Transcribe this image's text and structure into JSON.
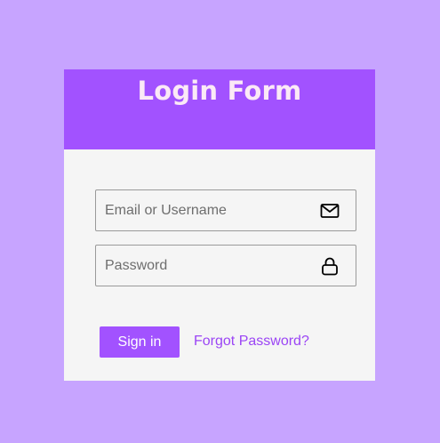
{
  "form": {
    "title": "Login Form",
    "email": {
      "placeholder": "Email or Username",
      "value": "",
      "icon": "mail-icon"
    },
    "password": {
      "placeholder": "Password",
      "value": "",
      "icon": "lock-icon"
    },
    "signin_label": "Sign in",
    "forgot_label": "Forgot Password?"
  },
  "colors": {
    "page_background": "#c7a4ff",
    "header_background": "#a252ff",
    "title_text": "#fbe9f6",
    "card_background": "#f5f5f5",
    "button_background": "#a252ff",
    "link_text": "#9b45f5"
  }
}
